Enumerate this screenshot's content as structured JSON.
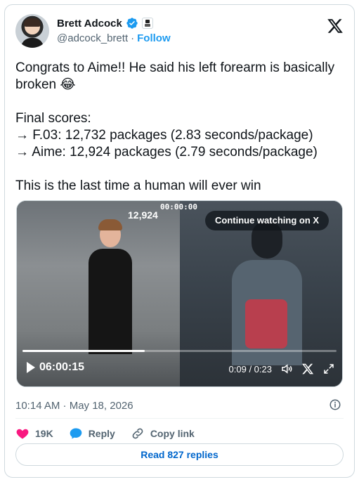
{
  "author": {
    "display_name": "Brett Adcock",
    "handle": "@adcock_brett",
    "separator": "·",
    "follow_label": "Follow"
  },
  "tweet": {
    "text": "Congrats to Aime!! He said his left forearm is basically broken 😂\n\nFinal scores:\n→ F.03: 12,732 packages (2.83 seconds/package)\n→ Aime: 12,924 packages (2.79 seconds/package)\n\nThis is the last time a human will ever win"
  },
  "video": {
    "overlay_timer": "00:00:00",
    "overlay_count": "12,924",
    "continue_label": "Continue watching on X",
    "elapsed_overlay": "06:00:15",
    "time_display": "0:09 / 0:23",
    "progress_fraction": 0.39
  },
  "meta": {
    "timestamp": "10:14 AM · May 18, 2026"
  },
  "actions": {
    "likes": "19K",
    "reply_label": "Reply",
    "copy_link_label": "Copy link"
  },
  "replies_button": "Read 827 replies",
  "colors": {
    "accent": "#1d9bf0",
    "like": "#f91880",
    "link": "#0066cc",
    "muted": "#536471"
  }
}
